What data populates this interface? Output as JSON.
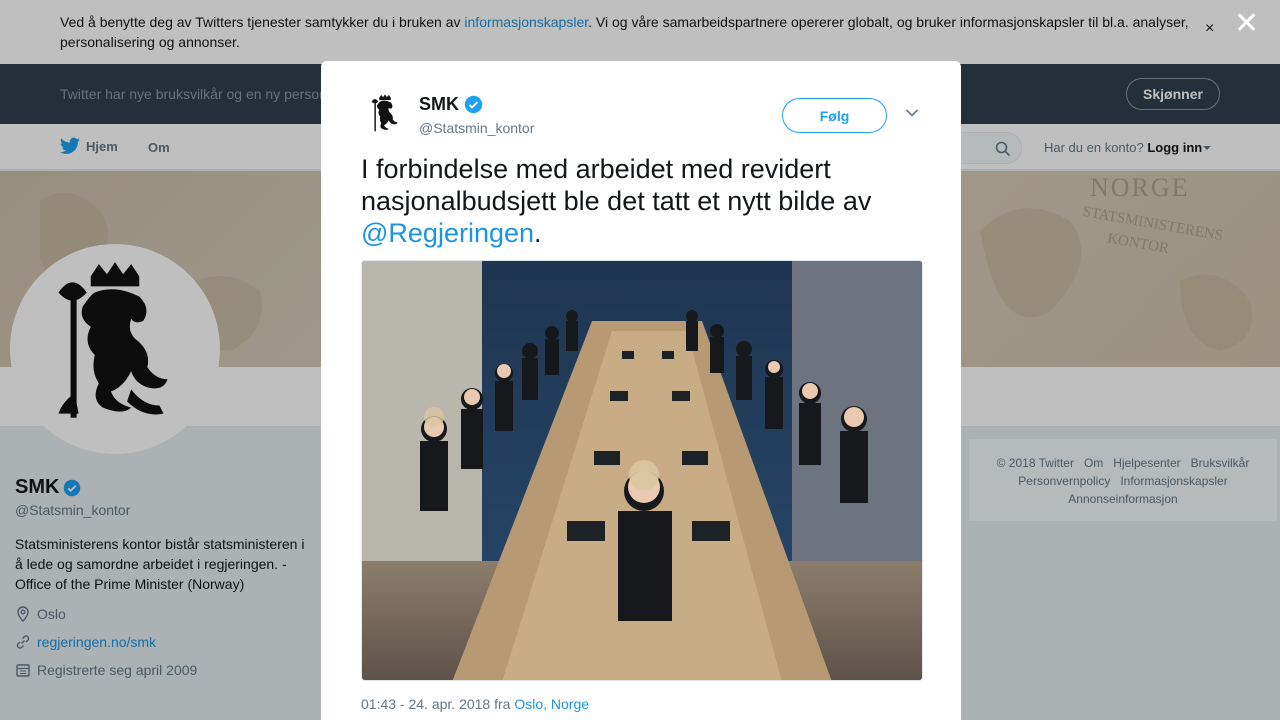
{
  "cookie_bar": {
    "text_before": "Ved å benytte deg av Twitters tjenester samtykker du i bruken av ",
    "link": "informasjonskapsler",
    "text_after": ". Vi og våre samarbeidspartnere opererer globalt, og bruker informasjonskapsler til bl.a. analyser, personalisering og annonser.",
    "close_glyph": "×"
  },
  "terms_bar": {
    "text": "Twitter har nye bruksvilkår og en ny personvernpolicy",
    "button": "Skjønner"
  },
  "nav": {
    "home": "Hjem",
    "about": "Om",
    "account_prompt": "Har du en konto?",
    "login": "Logg inn"
  },
  "banner": {
    "line1": "NORGE",
    "line2": "STATSMINISTERENS KONTOR"
  },
  "profile": {
    "name": "SMK",
    "handle": "@Statsmin_kontor",
    "bio": "Statsministerens kontor bistår statsministeren i å lede og samordne arbeidet i regjeringen. - Office of the Prime Minister (Norway)",
    "location": "Oslo",
    "website": "regjeringen.no/smk",
    "joined": "Registrerte seg april 2009"
  },
  "footer": {
    "links": [
      "© 2018 Twitter",
      "Om",
      "Hjelpesenter",
      "Bruksvilkår",
      "Personvernpolicy",
      "Informasjonskapsler",
      "Annonseinformasjon"
    ]
  },
  "overlay": {
    "close_glyph": "✕"
  },
  "tweet": {
    "name": "SMK",
    "handle": "@Statsmin_kontor",
    "follow_label": "Følg",
    "text": "I forbindelse med arbeidet med revidert nasjonalbudsjett ble det tatt et nytt bilde av ",
    "mention": "@Regjeringen",
    "text_end": ".",
    "timestamp": "01:43 - 24. apr. 2018 fra ",
    "location_link": "Oslo, Norge"
  },
  "colors": {
    "accent": "#1da1f2",
    "link": "#1b95e0",
    "terms_bg": "#2f3f4f",
    "verified": "#1da1f2"
  },
  "icons": {
    "logo": "twitter-bird-icon",
    "verified": "verified-badge-icon",
    "search": "search-icon",
    "caret": "chevron-down-icon",
    "location": "location-pin-icon",
    "link": "link-icon",
    "calendar": "calendar-icon"
  }
}
